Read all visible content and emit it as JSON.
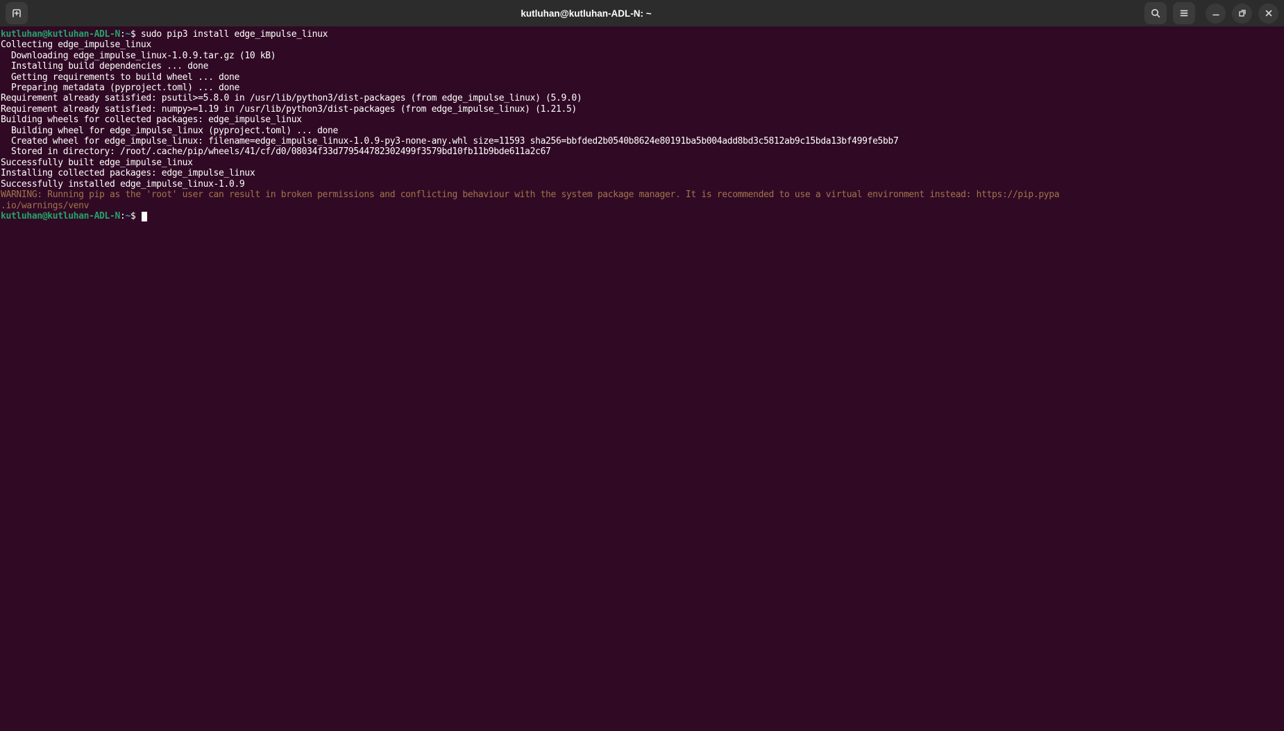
{
  "window": {
    "title": "kutluhan@kutluhan-ADL-N: ~",
    "header_icons": {
      "new_tab": "new-tab-icon",
      "search": "search-icon",
      "menu": "hamburger-menu-icon",
      "minimize": "minimize-icon",
      "restore": "restore-window-icon",
      "close": "close-icon"
    }
  },
  "colors": {
    "terminal_bg": "#300a24",
    "header_bg": "#2c2c2c",
    "prompt_green": "#26a269",
    "path_teal": "#2aa1b3",
    "warning": "#a2734c",
    "text": "#ffffff"
  },
  "terminal": {
    "prompt_user": "kutluhan@kutluhan-ADL-N",
    "prompt_path": "~",
    "command": "sudo pip3 install edge_impulse_linux",
    "lines": [
      {
        "segments": [
          {
            "text": "kutluhan@kutluhan-ADL-N",
            "style": "user"
          },
          {
            "text": ":",
            "style": "plain"
          },
          {
            "text": "~",
            "style": "path"
          },
          {
            "text": "$ sudo pip3 install edge_impulse_linux",
            "style": "plain"
          }
        ]
      },
      {
        "segments": [
          {
            "text": "Collecting edge_impulse_linux",
            "style": "plain"
          }
        ]
      },
      {
        "segments": [
          {
            "text": "  Downloading edge_impulse_linux-1.0.9.tar.gz (10 kB)",
            "style": "plain"
          }
        ]
      },
      {
        "segments": [
          {
            "text": "  Installing build dependencies ... done",
            "style": "plain"
          }
        ]
      },
      {
        "segments": [
          {
            "text": "  Getting requirements to build wheel ... done",
            "style": "plain"
          }
        ]
      },
      {
        "segments": [
          {
            "text": "  Preparing metadata (pyproject.toml) ... done",
            "style": "plain"
          }
        ]
      },
      {
        "segments": [
          {
            "text": "Requirement already satisfied: psutil>=5.8.0 in /usr/lib/python3/dist-packages (from edge_impulse_linux) (5.9.0)",
            "style": "plain"
          }
        ]
      },
      {
        "segments": [
          {
            "text": "Requirement already satisfied: numpy>=1.19 in /usr/lib/python3/dist-packages (from edge_impulse_linux) (1.21.5)",
            "style": "plain"
          }
        ]
      },
      {
        "segments": [
          {
            "text": "Building wheels for collected packages: edge_impulse_linux",
            "style": "plain"
          }
        ]
      },
      {
        "segments": [
          {
            "text": "  Building wheel for edge_impulse_linux (pyproject.toml) ... done",
            "style": "plain"
          }
        ]
      },
      {
        "segments": [
          {
            "text": "  Created wheel for edge_impulse_linux: filename=edge_impulse_linux-1.0.9-py3-none-any.whl size=11593 sha256=bbfded2b0540b8624e80191ba5b004add8bd3c5812ab9c15bda13bf499fe5bb7",
            "style": "plain"
          }
        ]
      },
      {
        "segments": [
          {
            "text": "  Stored in directory: /root/.cache/pip/wheels/41/cf/d0/08034f33d779544782302499f3579bd10fb11b9bde611a2c67",
            "style": "plain"
          }
        ]
      },
      {
        "segments": [
          {
            "text": "Successfully built edge_impulse_linux",
            "style": "plain"
          }
        ]
      },
      {
        "segments": [
          {
            "text": "Installing collected packages: edge_impulse_linux",
            "style": "plain"
          }
        ]
      },
      {
        "segments": [
          {
            "text": "Successfully installed edge_impulse_linux-1.0.9",
            "style": "plain"
          }
        ]
      },
      {
        "segments": [
          {
            "text": "WARNING: Running pip as the 'root' user can result in broken permissions and conflicting behaviour with the system package manager. It is recommended to use a virtual environment instead: https://pip.pypa",
            "style": "warn"
          }
        ]
      },
      {
        "segments": [
          {
            "text": ".io/warnings/venv",
            "style": "warn"
          }
        ]
      },
      {
        "cursor": true,
        "segments": [
          {
            "text": "kutluhan@kutluhan-ADL-N",
            "style": "user"
          },
          {
            "text": ":",
            "style": "plain"
          },
          {
            "text": "~",
            "style": "path"
          },
          {
            "text": "$ ",
            "style": "plain"
          }
        ]
      }
    ]
  }
}
